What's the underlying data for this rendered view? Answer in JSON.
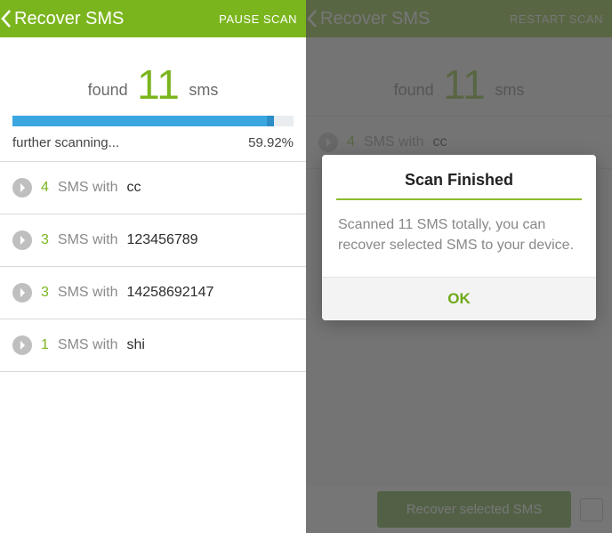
{
  "left": {
    "header": {
      "title": "Recover SMS",
      "action": "PAUSE SCAN"
    },
    "found": {
      "prefix": "found",
      "count": "11",
      "suffix": "sms"
    },
    "progress": {
      "percent": 59.92,
      "status": "further scanning...",
      "percentText": "59.92%"
    },
    "items": [
      {
        "count": "4",
        "mid": "SMS with",
        "contact": "cc"
      },
      {
        "count": "3",
        "mid": "SMS with",
        "contact": "123456789"
      },
      {
        "count": "3",
        "mid": "SMS with",
        "contact": "14258692147"
      },
      {
        "count": "1",
        "mid": "SMS with",
        "contact": "shi"
      }
    ]
  },
  "right": {
    "header": {
      "title": "Recover SMS",
      "action": "RESTART SCAN"
    },
    "found": {
      "prefix": "found",
      "count": "11",
      "suffix": "sms"
    },
    "items": [
      {
        "count": "4",
        "mid": "SMS with",
        "contact": "cc"
      }
    ],
    "dialog": {
      "title": "Scan Finished",
      "body": "Scanned 11 SMS totally, you can recover selected SMS to your device.",
      "ok": "OK"
    },
    "recoverButton": "Recover selected SMS"
  }
}
